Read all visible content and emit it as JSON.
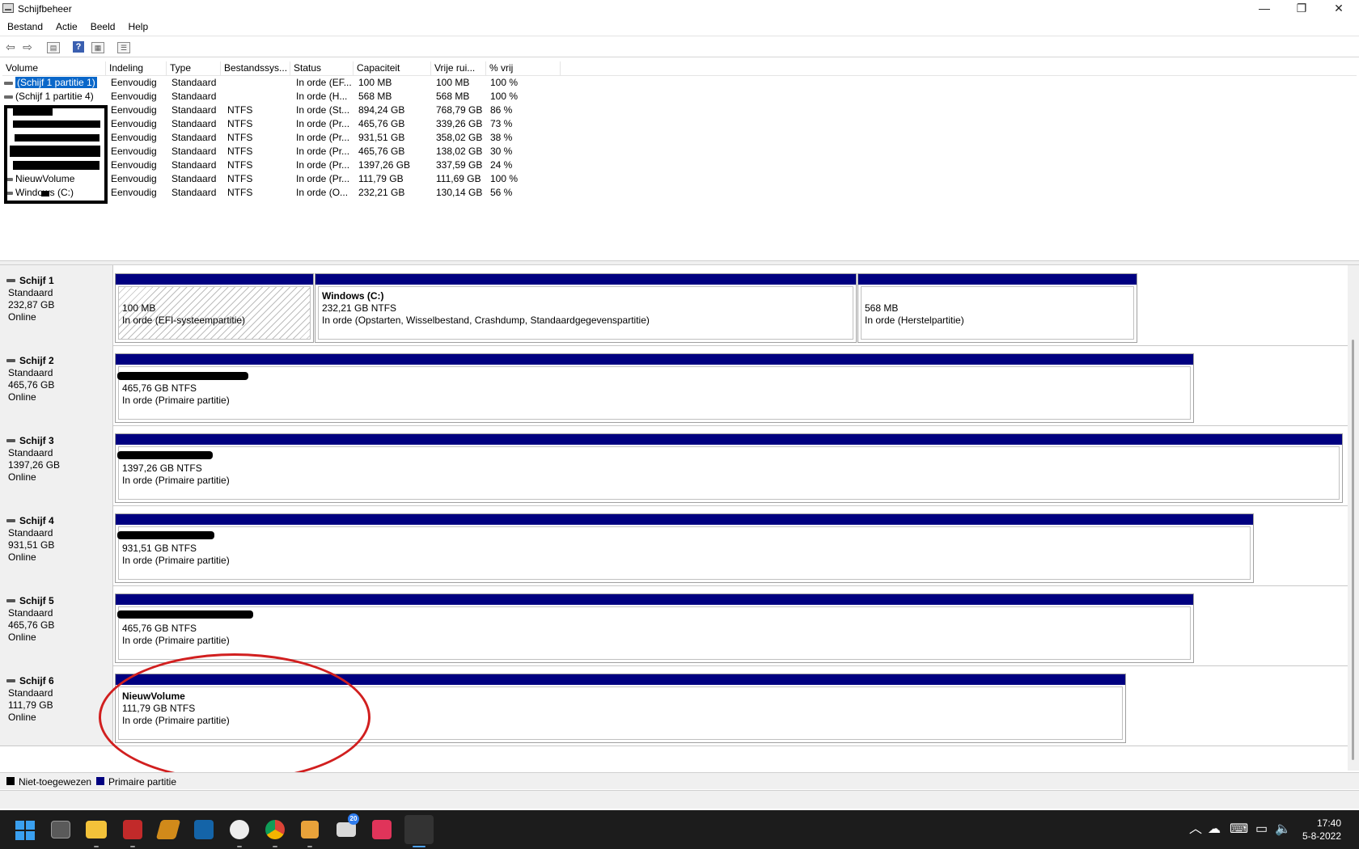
{
  "window": {
    "title": "Schijfbeheer",
    "minimize_glyph": "—",
    "restore_glyph": "❐",
    "close_glyph": "✕"
  },
  "menu": [
    "Bestand",
    "Actie",
    "Beeld",
    "Help"
  ],
  "toolbar": {
    "back_icon": "arrow-left-icon",
    "forward_icon": "arrow-right-icon",
    "help_glyph": "?"
  },
  "volume_table": {
    "columns": [
      "Volume",
      "Indeling",
      "Type",
      "Bestandssys...",
      "Status",
      "Capaciteit",
      "Vrije rui...",
      "% vrij"
    ],
    "rows": [
      {
        "volume": "(Schijf 1 partitie 1)",
        "indeling": "Eenvoudig",
        "type": "Standaard",
        "fs": "",
        "status": "In orde (EF...",
        "capacity": "100 MB",
        "free": "100 MB",
        "pct": "100 %"
      },
      {
        "volume": "(Schijf 1 partitie 4)",
        "indeling": "Eenvoudig",
        "type": "Standaard",
        "fs": "",
        "status": "In orde (H...",
        "capacity": "568 MB",
        "free": "568 MB",
        "pct": "100 %"
      },
      {
        "volume": "",
        "indeling": "Eenvoudig",
        "type": "Standaard",
        "fs": "NTFS",
        "status": "In orde (St...",
        "capacity": "894,24 GB",
        "free": "768,79 GB",
        "pct": "86 %"
      },
      {
        "volume": "",
        "indeling": "Eenvoudig",
        "type": "Standaard",
        "fs": "NTFS",
        "status": "In orde (Pr...",
        "capacity": "465,76 GB",
        "free": "339,26 GB",
        "pct": "73 %"
      },
      {
        "volume": "",
        "indeling": "Eenvoudig",
        "type": "Standaard",
        "fs": "NTFS",
        "status": "In orde (Pr...",
        "capacity": "931,51 GB",
        "free": "358,02 GB",
        "pct": "38 %"
      },
      {
        "volume": "",
        "indeling": "Eenvoudig",
        "type": "Standaard",
        "fs": "NTFS",
        "status": "In orde (Pr...",
        "capacity": "465,76 GB",
        "free": "138,02 GB",
        "pct": "30 %"
      },
      {
        "volume": "",
        "indeling": "Eenvoudig",
        "type": "Standaard",
        "fs": "NTFS",
        "status": "In orde (Pr...",
        "capacity": "1397,26 GB",
        "free": "337,59 GB",
        "pct": "24 %"
      },
      {
        "volume": "NieuwVolume",
        "indeling": "Eenvoudig",
        "type": "Standaard",
        "fs": "NTFS",
        "status": "In orde (Pr...",
        "capacity": "111,79 GB",
        "free": "111,69 GB",
        "pct": "100 %"
      },
      {
        "volume": "Windows (C:)",
        "indeling": "Eenvoudig",
        "type": "Standaard",
        "fs": "NTFS",
        "status": "In orde (O...",
        "capacity": "232,21 GB",
        "free": "130,14 GB",
        "pct": "56 %"
      }
    ]
  },
  "disks": [
    {
      "name": "Schijf 1",
      "type": "Standaard",
      "size": "232,87 GB",
      "state": "Online",
      "partitions": [
        {
          "name": "",
          "size": "100 MB",
          "status": "In orde (EFI-systeempartitie)"
        },
        {
          "name": "Windows  (C:)",
          "size": "232,21 GB NTFS",
          "status": "In orde (Opstarten, Wisselbestand, Crashdump, Standaardgegevenspartitie)"
        },
        {
          "name": "",
          "size": "568 MB",
          "status": "In orde (Herstelpartitie)"
        }
      ]
    },
    {
      "name": "Schijf 2",
      "type": "Standaard",
      "size": "465,76 GB",
      "state": "Online",
      "partitions": [
        {
          "name": "",
          "size": "465,76 GB NTFS",
          "status": "In orde (Primaire partitie)"
        }
      ]
    },
    {
      "name": "Schijf 3",
      "type": "Standaard",
      "size": "1397,26 GB",
      "state": "Online",
      "partitions": [
        {
          "name": "",
          "size": "1397,26 GB NTFS",
          "status": "In orde (Primaire partitie)"
        }
      ]
    },
    {
      "name": "Schijf 4",
      "type": "Standaard",
      "size": "931,51 GB",
      "state": "Online",
      "partitions": [
        {
          "name": "",
          "size": "931,51 GB NTFS",
          "status": "In orde (Primaire partitie)"
        }
      ]
    },
    {
      "name": "Schijf 5",
      "type": "Standaard",
      "size": "465,76 GB",
      "state": "Online",
      "partitions": [
        {
          "name": "",
          "size": "465,76 GB NTFS",
          "status": "In orde (Primaire partitie)"
        }
      ]
    },
    {
      "name": "Schijf 6",
      "type": "Standaard",
      "size": "111,79 GB",
      "state": "Online",
      "partitions": [
        {
          "name": "NieuwVolume",
          "size": "111,79 GB NTFS",
          "status": "In orde (Primaire partitie)"
        }
      ]
    }
  ],
  "legend": {
    "unallocated": "Niet-toegewezen",
    "primary": "Primaire partitie",
    "unallocated_color": "#000000",
    "primary_color": "#000080"
  },
  "taskbar": {
    "mail_badge": "20",
    "time": "17:40",
    "date": "5-8-2022"
  }
}
